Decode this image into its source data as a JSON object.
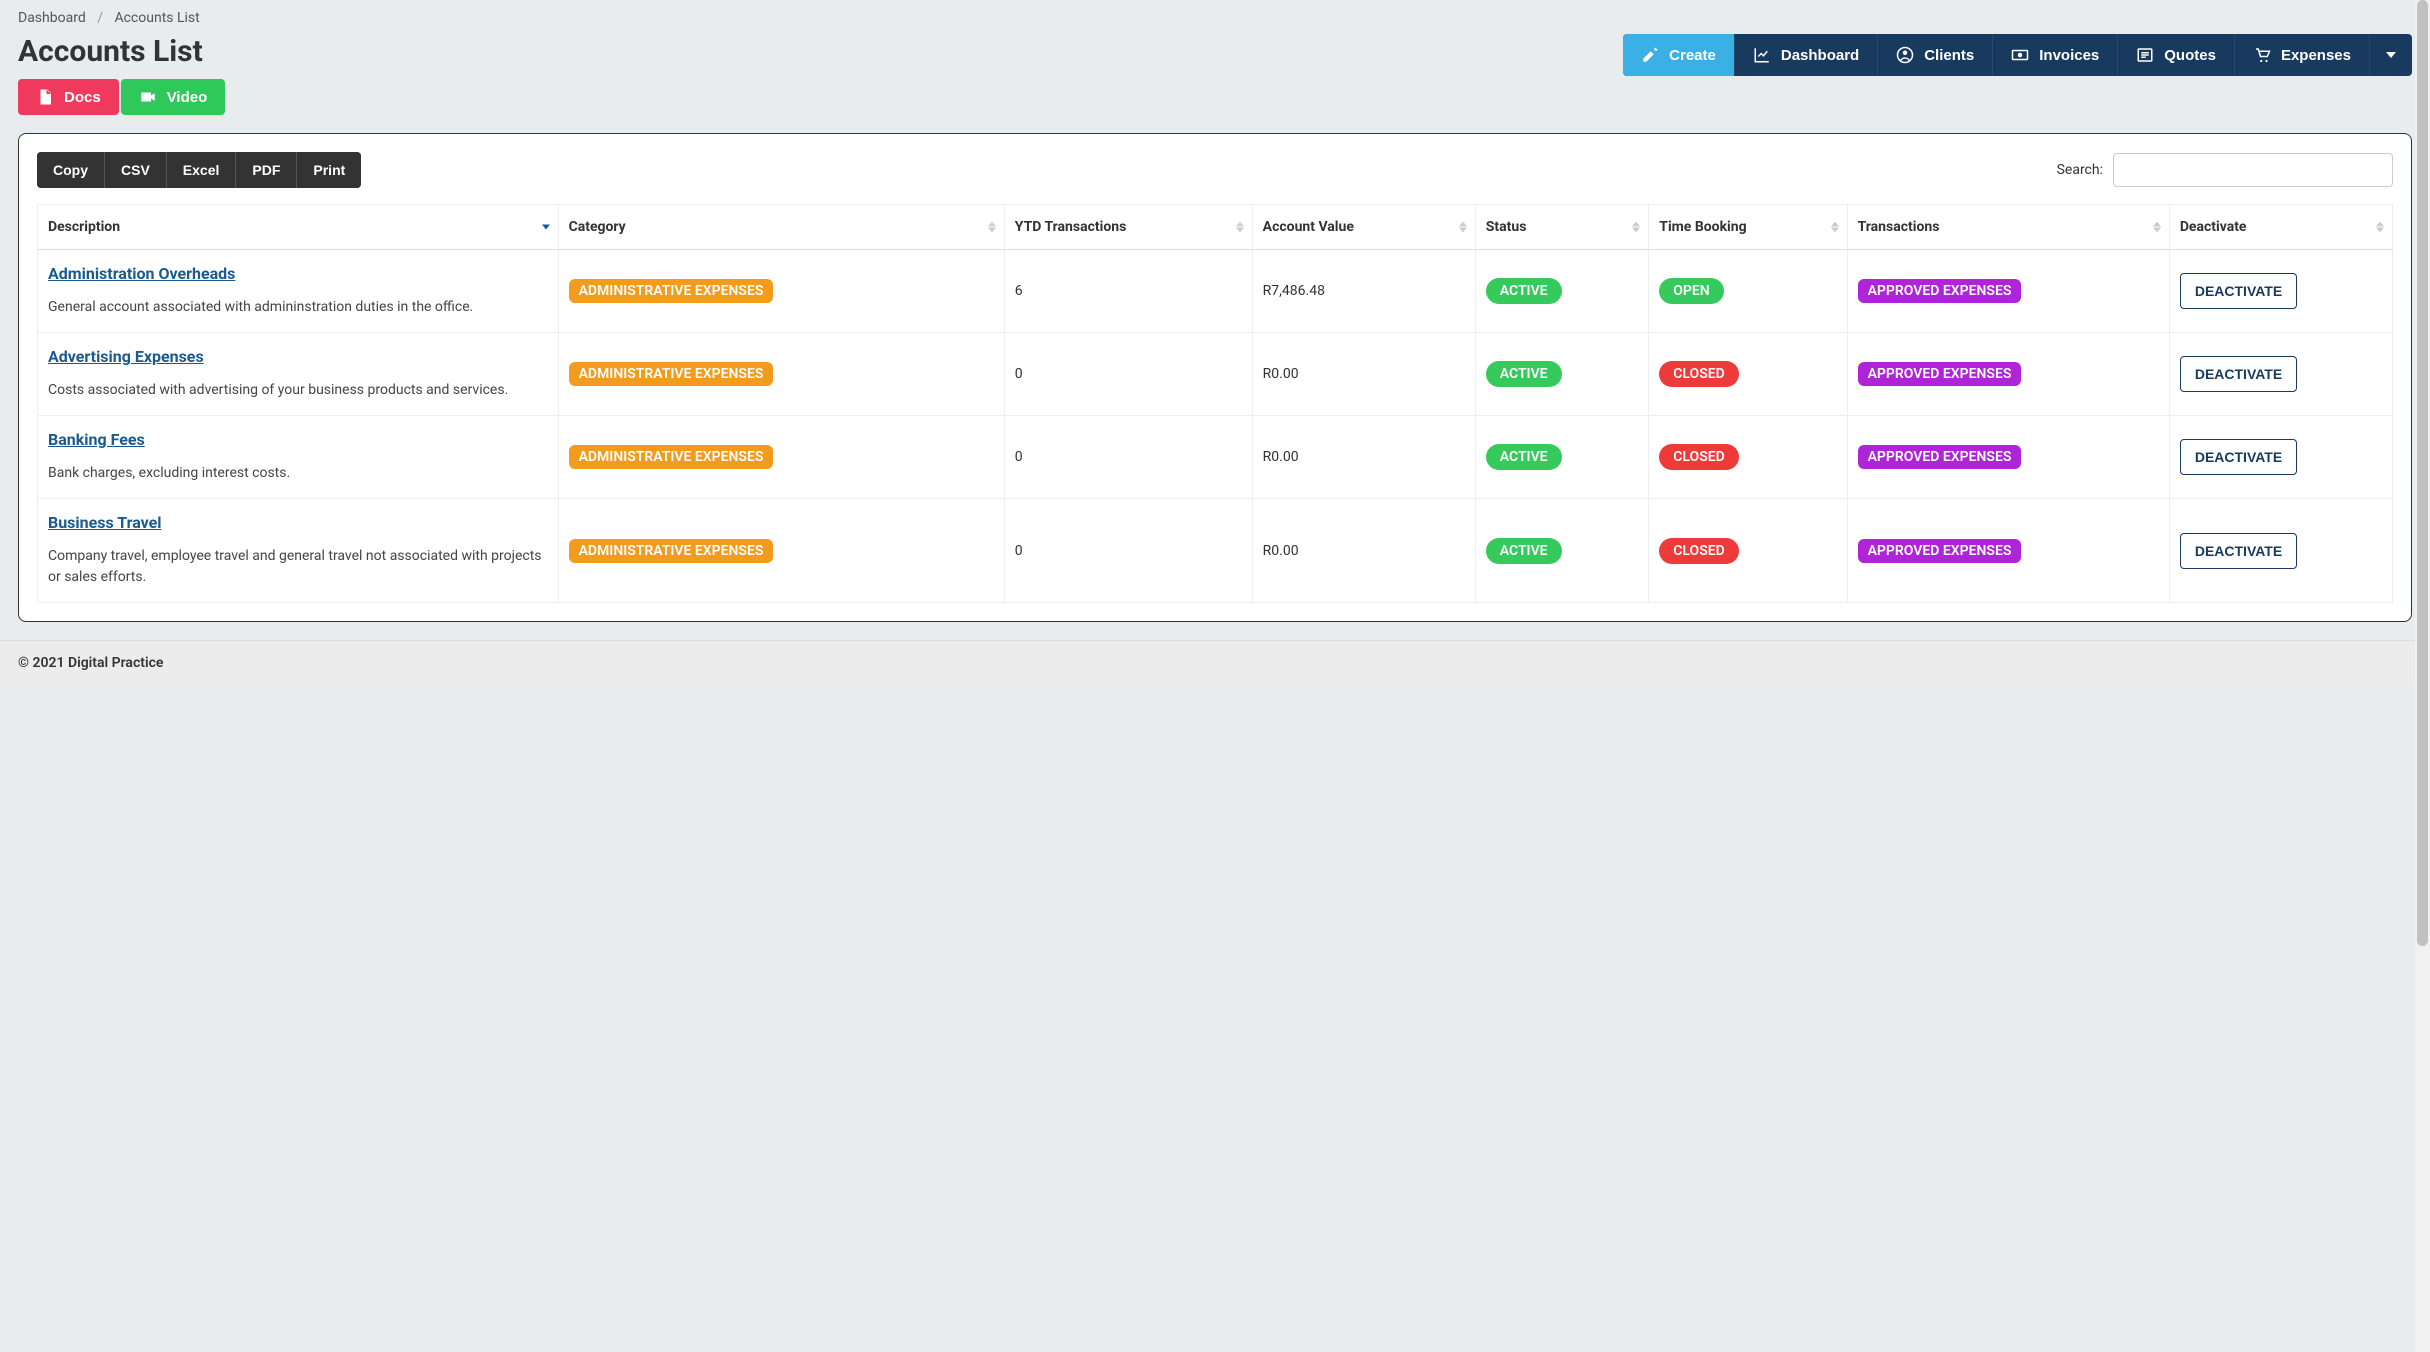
{
  "breadcrumb": {
    "dashboard": "Dashboard",
    "current": "Accounts List"
  },
  "page_title": "Accounts List",
  "help_buttons": {
    "docs": "Docs",
    "video": "Video"
  },
  "nav": {
    "create": "Create",
    "dashboard": "Dashboard",
    "clients": "Clients",
    "invoices": "Invoices",
    "quotes": "Quotes",
    "expenses": "Expenses"
  },
  "export": {
    "copy": "Copy",
    "csv": "CSV",
    "excel": "Excel",
    "pdf": "PDF",
    "print": "Print"
  },
  "search_label": "Search:",
  "search_value": "",
  "columns": {
    "description": "Description",
    "category": "Category",
    "ytd": "YTD Transactions",
    "value": "Account Value",
    "status": "Status",
    "time": "Time Booking",
    "transactions": "Transactions",
    "deactivate": "Deactivate"
  },
  "deactivate_label": "DEACTIVATE",
  "rows": [
    {
      "title": "Administration Overheads",
      "desc": "General account associated with admininstration duties in the office.",
      "category": "ADMINISTRATIVE EXPENSES",
      "ytd": "6",
      "value": "R7,486.48",
      "status": "ACTIVE",
      "time": "OPEN",
      "time_color": "green",
      "transactions": "APPROVED EXPENSES"
    },
    {
      "title": "Advertising Expenses",
      "desc": "Costs associated with advertising of your business products and services.",
      "category": "ADMINISTRATIVE EXPENSES",
      "ytd": "0",
      "value": "R0.00",
      "status": "ACTIVE",
      "time": "CLOSED",
      "time_color": "red",
      "transactions": "APPROVED EXPENSES"
    },
    {
      "title": "Banking Fees",
      "desc": "Bank charges, excluding interest costs.",
      "category": "ADMINISTRATIVE EXPENSES",
      "ytd": "0",
      "value": "R0.00",
      "status": "ACTIVE",
      "time": "CLOSED",
      "time_color": "red",
      "transactions": "APPROVED EXPENSES"
    },
    {
      "title": "Business Travel",
      "desc": "Company travel, employee travel and general travel not associated with projects or sales efforts.",
      "category": "ADMINISTRATIVE EXPENSES",
      "ytd": "0",
      "value": "R0.00",
      "status": "ACTIVE",
      "time": "CLOSED",
      "time_color": "red",
      "transactions": "APPROVED EXPENSES"
    }
  ],
  "footer": "© 2021 Digital Practice"
}
